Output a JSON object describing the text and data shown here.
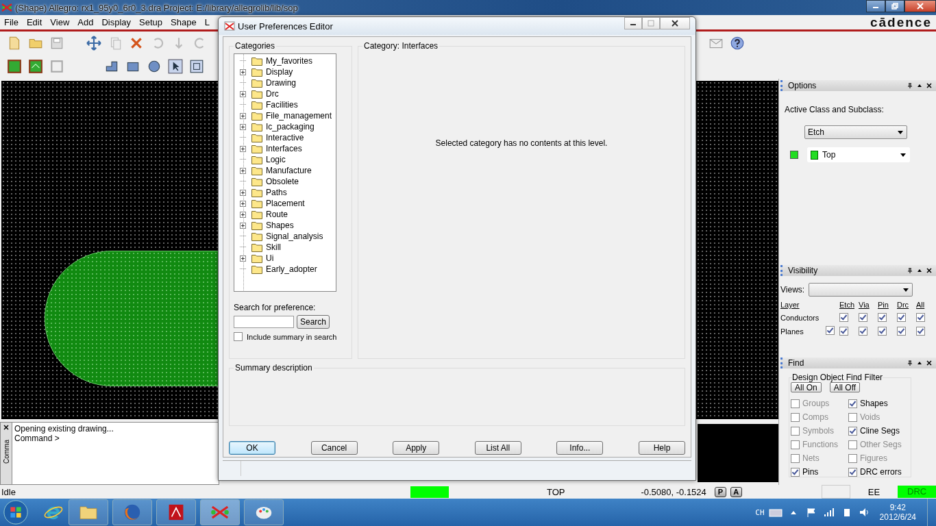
{
  "app_window": {
    "title": "(Shape) Allegro: rx1_95y0_6r0_3.dra  Project: E:/library/allegrolib/lib/sop",
    "logo": "cādence"
  },
  "menu": [
    "File",
    "Edit",
    "View",
    "Add",
    "Display",
    "Setup",
    "Shape",
    "L"
  ],
  "command_window": {
    "tab_label": "Comma",
    "lines": [
      "Opening existing drawing...",
      "Command >"
    ]
  },
  "options_panel": {
    "title": "Options",
    "label": "Active Class and Subclass:",
    "class_value": "Etch",
    "subclass_value": "Top"
  },
  "visibility_panel": {
    "title": "Visibility",
    "views_label": "Views:",
    "layer_header": "Layer",
    "columns": [
      "Etch",
      "Via",
      "Pin",
      "Drc",
      "All"
    ],
    "rows": [
      {
        "label": "Conductors",
        "cells": [
          true,
          true,
          true,
          true,
          true
        ]
      },
      {
        "label": "Planes",
        "row_checked": true,
        "cells": [
          true,
          true,
          true,
          true,
          true
        ]
      }
    ]
  },
  "find_panel": {
    "title": "Find",
    "group_label": "Design Object Find Filter",
    "buttons": [
      "All On",
      "All Off"
    ],
    "items": [
      {
        "label": "Groups",
        "checked": false
      },
      {
        "label": "Shapes",
        "checked": true
      },
      {
        "label": "Comps",
        "checked": false
      },
      {
        "label": "Voids",
        "checked": false
      },
      {
        "label": "Symbols",
        "checked": false
      },
      {
        "label": "Cline Segs",
        "checked": true
      },
      {
        "label": "Functions",
        "checked": false
      },
      {
        "label": "Other Segs",
        "checked": false
      },
      {
        "label": "Nets",
        "checked": false
      },
      {
        "label": "Figures",
        "checked": false
      },
      {
        "label": "Pins",
        "checked": true
      },
      {
        "label": "DRC errors",
        "checked": true
      }
    ]
  },
  "dialog": {
    "title": "User Preferences Editor",
    "categories_label": "Categories",
    "categories": [
      {
        "label": "My_favorites",
        "expandable": false
      },
      {
        "label": "Display",
        "expandable": true
      },
      {
        "label": "Drawing",
        "expandable": false
      },
      {
        "label": "Drc",
        "expandable": true
      },
      {
        "label": "Facilities",
        "expandable": false
      },
      {
        "label": "File_management",
        "expandable": true
      },
      {
        "label": "Ic_packaging",
        "expandable": true
      },
      {
        "label": "Interactive",
        "expandable": false
      },
      {
        "label": "Interfaces",
        "expandable": true
      },
      {
        "label": "Logic",
        "expandable": false
      },
      {
        "label": "Manufacture",
        "expandable": true
      },
      {
        "label": "Obsolete",
        "expandable": false
      },
      {
        "label": "Paths",
        "expandable": true
      },
      {
        "label": "Placement",
        "expandable": true
      },
      {
        "label": "Route",
        "expandable": true
      },
      {
        "label": "Shapes",
        "expandable": true
      },
      {
        "label": "Signal_analysis",
        "expandable": false
      },
      {
        "label": "Skill",
        "expandable": false
      },
      {
        "label": "Ui",
        "expandable": true
      },
      {
        "label": "Early_adopter",
        "expandable": false
      }
    ],
    "search_label": "Search for preference:",
    "search_button": "Search",
    "include_summary": {
      "label": "Include summary in search",
      "checked": false
    },
    "category_label": "Category:",
    "category_value": "Interfaces",
    "message": "Selected category has no contents at this level.",
    "summary_label": "Summary description",
    "buttons": [
      {
        "label": "OK",
        "default": true
      },
      {
        "label": "Cancel",
        "default": false
      },
      {
        "label": "Apply",
        "default": false
      },
      {
        "label": "List All",
        "default": false
      },
      {
        "label": "Info...",
        "default": false
      },
      {
        "label": "Help",
        "default": false
      }
    ]
  },
  "status_bar": {
    "state": "Idle",
    "layer": "TOP",
    "coordinates": "-0.5080, -0.1524",
    "buttons": [
      "P",
      "A"
    ],
    "mode": "EE",
    "drc": "DRC"
  },
  "taskbar": {
    "language": "CH",
    "time": "9:42",
    "date": "2012/6/24"
  }
}
